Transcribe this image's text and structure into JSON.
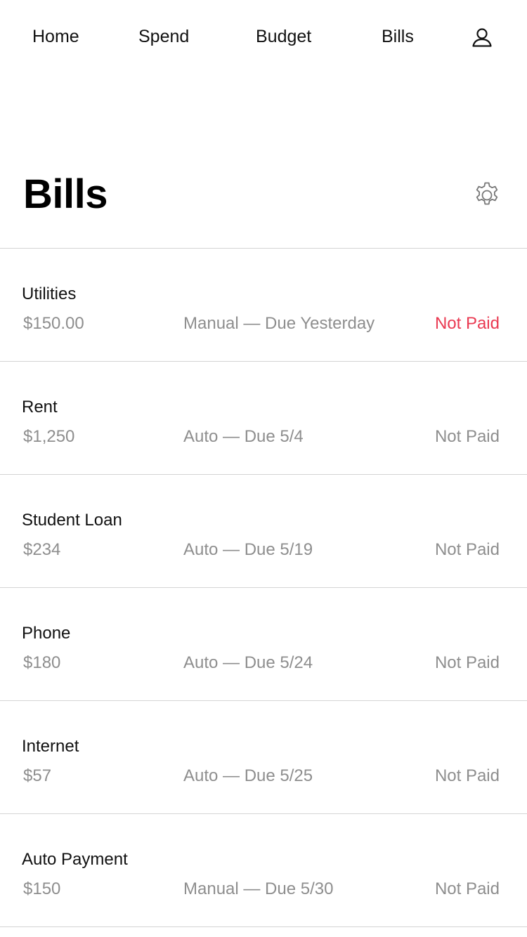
{
  "nav": {
    "items": [
      {
        "label": "Home"
      },
      {
        "label": "Spend"
      },
      {
        "label": "Budget"
      },
      {
        "label": "Bills"
      }
    ],
    "profile_icon": "user-icon"
  },
  "page": {
    "title": "Bills",
    "settings_icon": "gear-icon"
  },
  "colors": {
    "overdue_status": "#ea3a52",
    "secondary_text": "#8e8e8e",
    "divider": "#d4d4d4"
  },
  "bills": [
    {
      "name": "Utilities",
      "amount": "$150.00",
      "schedule": "Manual — Due Yesterday",
      "status": "Not Paid",
      "overdue": true
    },
    {
      "name": "Rent",
      "amount": "$1,250",
      "schedule": "Auto — Due 5/4",
      "status": "Not Paid",
      "overdue": false
    },
    {
      "name": "Student Loan",
      "amount": "$234",
      "schedule": "Auto — Due 5/19",
      "status": "Not Paid",
      "overdue": false
    },
    {
      "name": "Phone",
      "amount": "$180",
      "schedule": "Auto — Due 5/24",
      "status": "Not Paid",
      "overdue": false
    },
    {
      "name": "Internet",
      "amount": "$57",
      "schedule": "Auto — Due 5/25",
      "status": "Not Paid",
      "overdue": false
    },
    {
      "name": "Auto Payment",
      "amount": "$150",
      "schedule": "Manual — Due 5/30",
      "status": "Not Paid",
      "overdue": false
    }
  ]
}
